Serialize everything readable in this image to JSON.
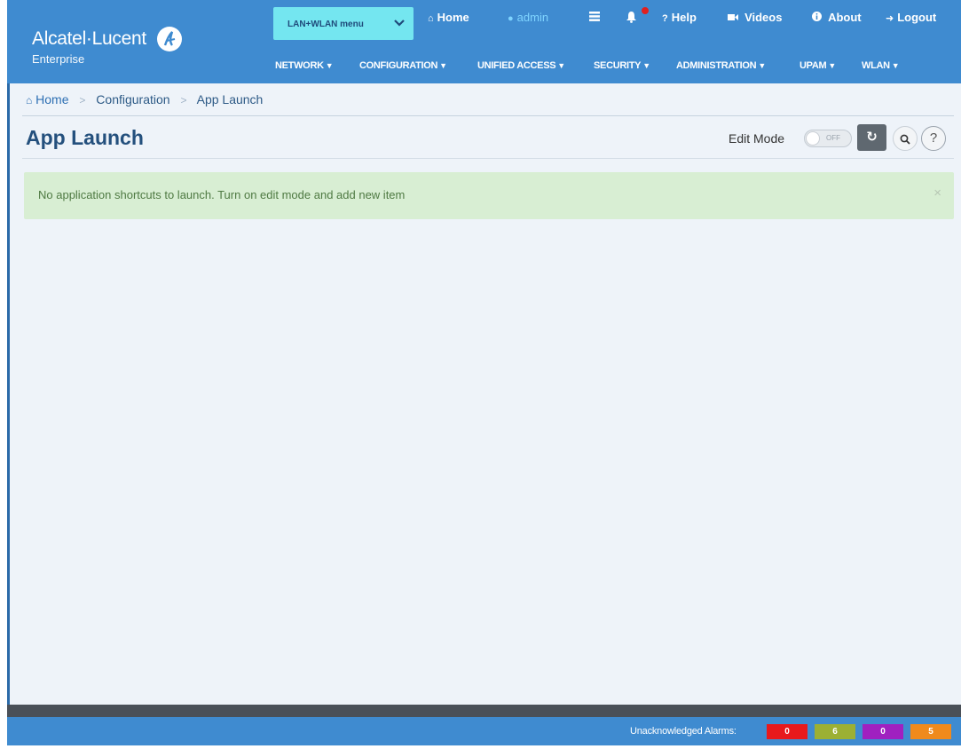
{
  "brand": {
    "name": "Alcatel·Lucent",
    "subtitle": "Enterprise"
  },
  "header": {
    "menu_select": {
      "value": "LAN+WLAN menu"
    },
    "top_links": [
      {
        "label": "Home",
        "icon": "home-icon"
      },
      {
        "label": "admin",
        "icon": "user-icon"
      },
      {
        "label": "",
        "icon": "list-icon"
      },
      {
        "label": "",
        "icon": "bell-icon"
      },
      {
        "label": "Help",
        "icon": "question-icon"
      },
      {
        "label": "Videos",
        "icon": "video-icon"
      },
      {
        "label": "About",
        "icon": "info-icon"
      },
      {
        "label": "Logout",
        "icon": "logout-icon"
      }
    ],
    "main_nav": [
      "NETWORK",
      "CONFIGURATION",
      "UNIFIED ACCESS",
      "SECURITY",
      "ADMINISTRATION",
      "UPAM",
      "WLAN"
    ]
  },
  "breadcrumb": [
    "Home",
    "Configuration",
    "App Launch"
  ],
  "page": {
    "title": "App Launch",
    "edit_mode_label": "Edit Mode",
    "edit_mode_state": "OFF"
  },
  "alert": {
    "message": "No application shortcuts to launch. Turn on edit mode and add new item",
    "close": "×"
  },
  "footer": {
    "alarms_label": "Unacknowledged Alarms:",
    "alarms": [
      {
        "value": "0",
        "color": "#e8191c"
      },
      {
        "value": "6",
        "color": "#9cb033"
      },
      {
        "value": "0",
        "color": "#a020c0"
      },
      {
        "value": "5",
        "color": "#f08a1c"
      }
    ]
  }
}
